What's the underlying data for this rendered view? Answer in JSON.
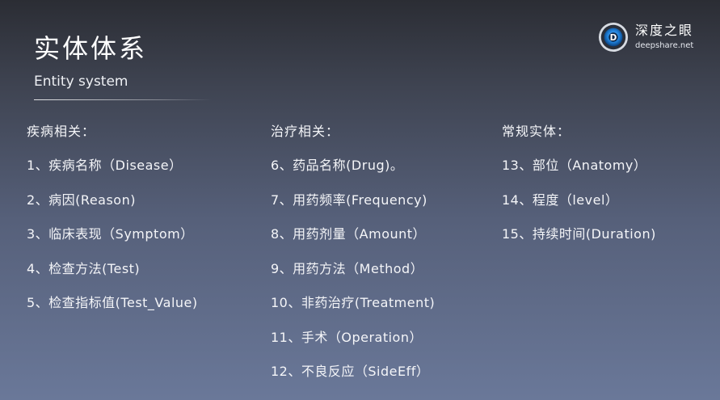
{
  "slide": {
    "title": "实体体系",
    "subtitle": "Entity system"
  },
  "logo": {
    "name": "深度之眼",
    "url": "deepshare.net",
    "colors": {
      "ring": "#1f7fd8",
      "core": "#0d2748"
    }
  },
  "columns": [
    {
      "heading": "疾病相关：",
      "items": [
        "1、疾病名称（Disease）",
        "2、病因(Reason)",
        "3、临床表现（Symptom）",
        "4、检查方法(Test)",
        "5、检查指标值(Test_Value)"
      ]
    },
    {
      "heading": "治疗相关：",
      "items": [
        "6、药品名称(Drug)。",
        "7、用药频率(Frequency)",
        "8、用药剂量（Amount）",
        "9、用药方法（Method）",
        "10、非药治疗(Treatment)",
        "11、手术（Operation）",
        "12、不良反应（SideEff）"
      ]
    },
    {
      "heading": "常规实体：",
      "items": [
        "13、部位（Anatomy）",
        "14、程度（level）",
        "15、持续时间(Duration)"
      ]
    }
  ]
}
